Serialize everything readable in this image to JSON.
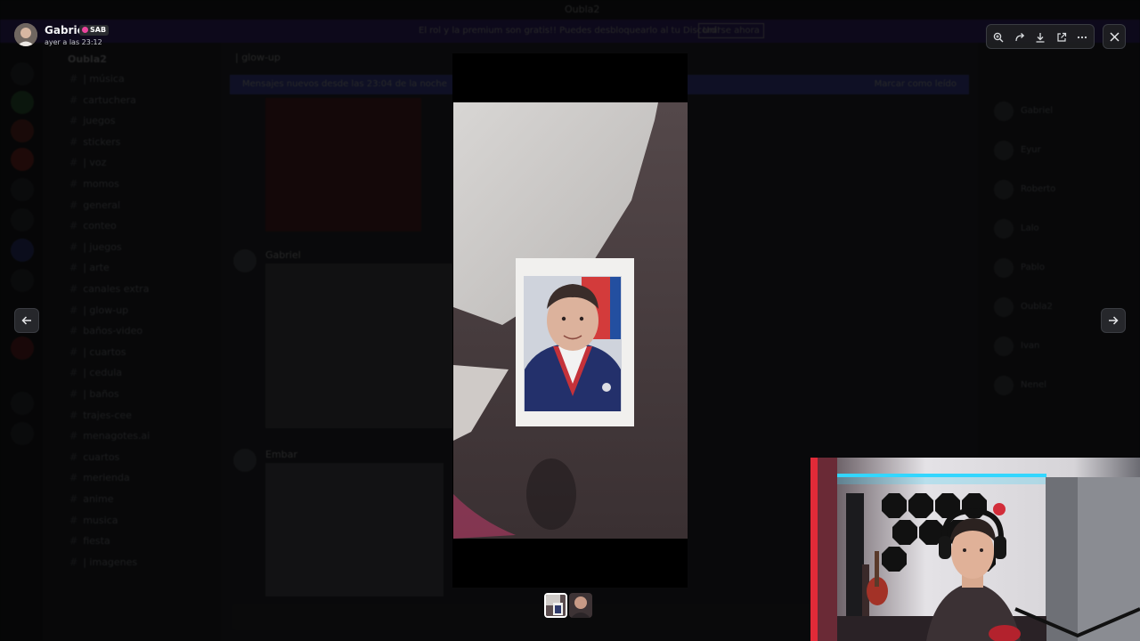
{
  "background_app": {
    "window_title": "Oubla2",
    "banner_text": "El rol y la premium son gratis!! Puedes desbloquearlo al tu Discord!",
    "banner_button": "Unirse ahora",
    "guild_name": "Oubla2",
    "channels": [
      "| música",
      "cartuchera",
      "juegos",
      "stickers",
      "| voz",
      "momos",
      "general",
      "conteo",
      "| juegos",
      "| arte",
      "canales extra",
      "| glow-up",
      "baños-video",
      "| cuartos",
      "| cedula",
      "| baños",
      "trajes-cee",
      "menagotes.ai",
      "cuartos",
      "merienda",
      "anime",
      "musica",
      "fiesta",
      "| imagenes"
    ],
    "chat_header": "| glow-up",
    "chat_notice": "Mensajes nuevos desde las 23:04 de la noche",
    "chat_notice_right": "Marcar como leído",
    "authors": [
      "Gabriel",
      "Embar"
    ],
    "members": [
      "Gabriel",
      "Eyur",
      "Roberto",
      "Lalo",
      "Pablo",
      "Oubla2",
      "Ivan",
      "Nenel"
    ]
  },
  "viewer": {
    "author_name": "Gabriel",
    "author_tag": "SAB",
    "timestamp": "ayer a las 23:12",
    "toolbar_icons": [
      "zoom-icon",
      "forward-icon",
      "download-icon",
      "open-external-icon",
      "more-icon"
    ],
    "close_icon": "close-icon",
    "prev_icon": "arrow-left-icon",
    "next_icon": "arrow-right-icon",
    "image_description": "photo of an ID-style portrait print lying on a fabric surface",
    "thumbnails": 2,
    "selected_thumbnail": 1
  },
  "colors": {
    "accent": "#5865f2",
    "banner": "#4a2fa8",
    "tag_badge": "#eb459e",
    "led_red": "#ff2a3a",
    "led_cyan": "#33d6ff"
  }
}
